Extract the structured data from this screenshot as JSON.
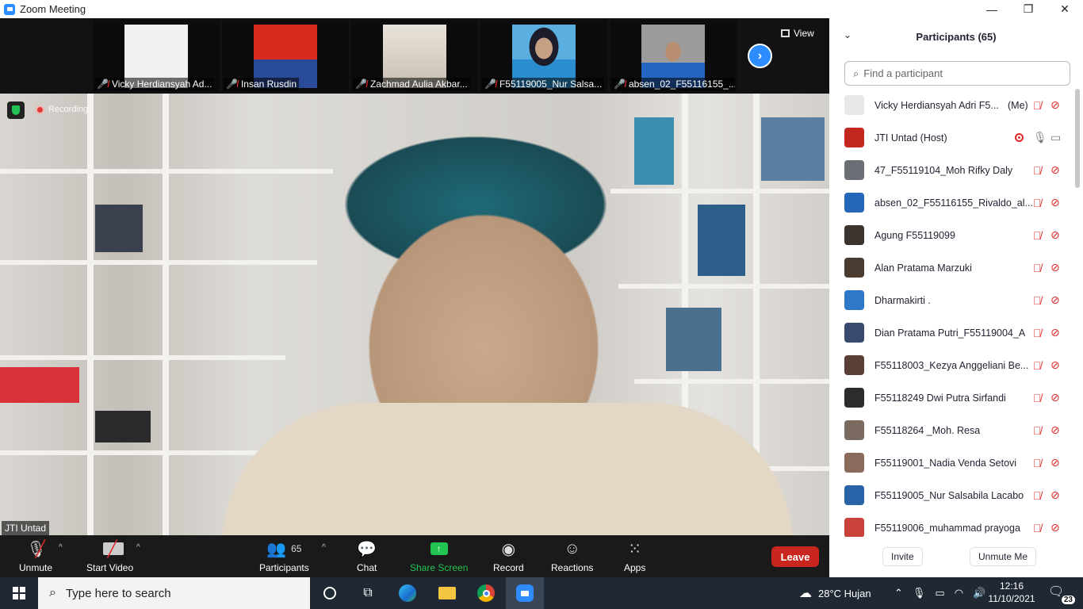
{
  "window": {
    "title": "Zoom Meeting",
    "controls": [
      "—",
      "❐",
      "✕"
    ]
  },
  "strip": {
    "view_label": "View",
    "thumbnails": [
      {
        "name": "Vicky Herdiansyah Ad...",
        "color": "#f0f0f0"
      },
      {
        "name": "Insan Rusdin",
        "color": "#d82a1e"
      },
      {
        "name": "Zachmad Aulia Akbar...",
        "color": "#d6cfc4"
      },
      {
        "name": "F55119005_Nur Salsa...",
        "color": "#2a8ed0"
      },
      {
        "name": "absen_02_F55116155_...",
        "color": "#9a9a9a"
      }
    ]
  },
  "main_video": {
    "recording_label": "Recording",
    "speaker_name": "JTI Untad"
  },
  "toolbar": {
    "unmute": "Unmute",
    "start_video": "Start Video",
    "participants": "Participants",
    "participants_count": "65",
    "chat": "Chat",
    "share_screen": "Share Screen",
    "record": "Record",
    "reactions": "Reactions",
    "apps": "Apps",
    "leave": "Leave"
  },
  "panel": {
    "title": "Participants (65)",
    "search_placeholder": "Find a participant",
    "invite": "Invite",
    "unmute_me": "Unmute Me",
    "participants": [
      {
        "name": "Vicky Herdiansyah Adri F5...",
        "tag": "(Me)",
        "avatar": "#e8e8e8"
      },
      {
        "name": "JTI Untad (Host)",
        "tag": "",
        "avatar": "#c3281e",
        "host": true
      },
      {
        "name": "47_F55119104_Moh Rifky Daly",
        "tag": "",
        "avatar": "#6a6f76"
      },
      {
        "name": "absen_02_F55116155_Rivaldo_al...",
        "tag": "",
        "avatar": "#2466b8"
      },
      {
        "name": "Agung F55119099",
        "tag": "",
        "avatar": "#3b342e"
      },
      {
        "name": "Alan Pratama Marzuki",
        "tag": "",
        "avatar": "#4a3b30"
      },
      {
        "name": "Dharmakirti .",
        "tag": "",
        "avatar": "#2f78c8"
      },
      {
        "name": "Dian Pratama Putri_F55119004_A",
        "tag": "",
        "avatar": "#3a4a6e"
      },
      {
        "name": "F55118003_Kezya Anggeliani Be...",
        "tag": "",
        "avatar": "#5a3f36"
      },
      {
        "name": "F55118249 Dwi Putra Sirfandi",
        "tag": "",
        "avatar": "#2c2c2c"
      },
      {
        "name": "F55118264 _Moh. Resa",
        "tag": "",
        "avatar": "#7a6a60"
      },
      {
        "name": "F55119001_Nadia Venda Setovi",
        "tag": "",
        "avatar": "#8a6a5a"
      },
      {
        "name": "F55119005_Nur Salsabila Lacabo",
        "tag": "",
        "avatar": "#2a64a8"
      },
      {
        "name": "F55119006_muhammad prayoga",
        "tag": "",
        "avatar": "#c8423a"
      }
    ]
  },
  "taskbar": {
    "search_placeholder": "Type here to search",
    "weather": "28°C  Hujan",
    "time": "12:16",
    "date": "11/10/2021",
    "notifications": "23"
  }
}
